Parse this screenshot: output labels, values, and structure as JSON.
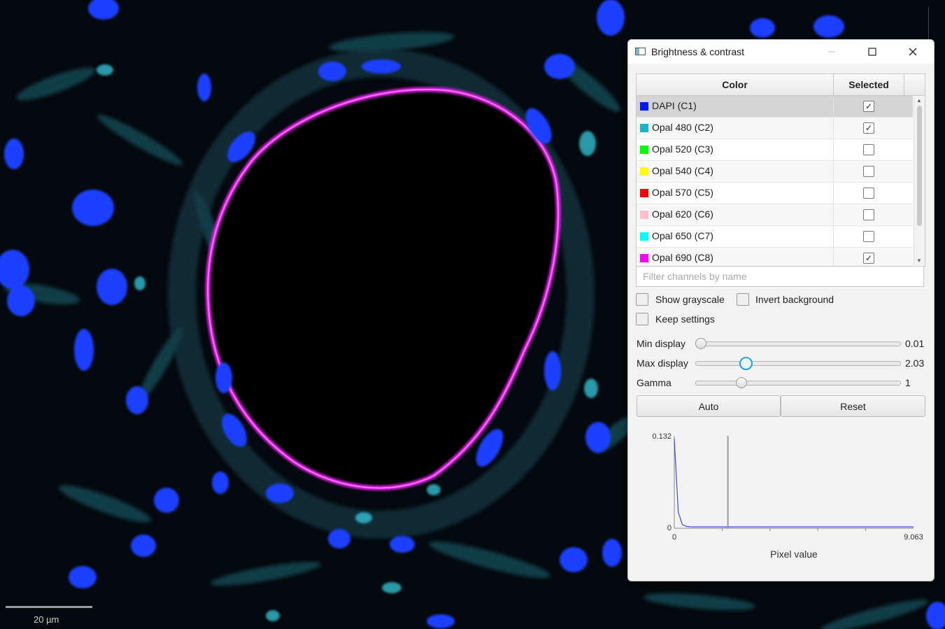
{
  "viewer": {
    "scale_bar_label": "20 µm"
  },
  "dialog": {
    "title": "Brightness & contrast",
    "table": {
      "headers": {
        "color": "Color",
        "selected": "Selected"
      },
      "channels": [
        {
          "name": "DAPI (C1)",
          "color": "#0018ff",
          "selected": true
        },
        {
          "name": "Opal 480 (C2)",
          "color": "#20b0c8",
          "selected": true
        },
        {
          "name": "Opal 520 (C3)",
          "color": "#00ff00",
          "selected": false
        },
        {
          "name": "Opal 540 (C4)",
          "color": "#ffff00",
          "selected": false
        },
        {
          "name": "Opal 570 (C5)",
          "color": "#ff0000",
          "selected": false
        },
        {
          "name": "Opal 620 (C6)",
          "color": "#ffc0cb",
          "selected": false
        },
        {
          "name": "Opal 650 (C7)",
          "color": "#00ffff",
          "selected": false
        },
        {
          "name": "Opal 690 (C8)",
          "color": "#ff00ff",
          "selected": true
        }
      ],
      "highlighted_row": 0
    },
    "filter_placeholder": "Filter channels by name",
    "options": {
      "show_grayscale": "Show grayscale",
      "invert_background": "Invert background",
      "keep_settings": "Keep settings"
    },
    "sliders": {
      "min_display": {
        "label": "Min display",
        "value_text": "0.01",
        "fraction": 0.0
      },
      "max_display": {
        "label": "Max display",
        "value_text": "2.03",
        "fraction": 0.23
      },
      "gamma": {
        "label": "Gamma",
        "value_text": "1",
        "fraction": 0.21
      }
    },
    "buttons": {
      "auto": "Auto",
      "reset": "Reset"
    },
    "histogram": {
      "y_max_label": "0.132",
      "y_min_label": "0",
      "x_min_label": "0",
      "x_max_label": "9.063",
      "xlabel": "Pixel value",
      "marker_value": 2.03,
      "x_max": 9.063,
      "line_color": "#3a4fd8"
    }
  }
}
